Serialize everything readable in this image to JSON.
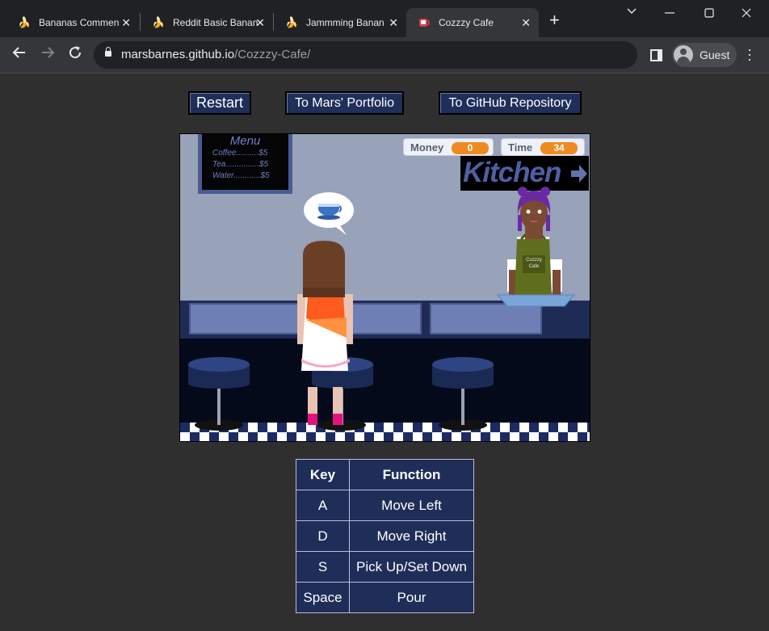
{
  "browser": {
    "tabs": [
      {
        "title": "Bananas Commen",
        "icon": "banana-icon"
      },
      {
        "title": "Reddit Basic Banan",
        "icon": "banana-icon"
      },
      {
        "title": "Jammming Banan",
        "icon": "banana-icon"
      },
      {
        "title": "Cozzzy Cafe",
        "icon": "coffee-cup-icon"
      }
    ],
    "url_domain": "marsbarnes.github.io",
    "url_path": "/Cozzzy-Cafe/",
    "profile_label": "Guest"
  },
  "page": {
    "buttons": {
      "restart": "Restart",
      "portfolio": "To Mars' Portfolio",
      "github": "To GitHub Repository"
    }
  },
  "game": {
    "menu": {
      "title": "Menu",
      "items": [
        "Coffee..........$5",
        "Tea...............$5",
        "Water............$5"
      ]
    },
    "hud": {
      "money_label": "Money",
      "money_value": "0",
      "time_label": "Time",
      "time_value": "34"
    },
    "kitchen_sign": "Kitchen",
    "apron_text_1": "Cozzzy",
    "apron_text_2": "Cafe",
    "order_icon": "coffee-cup-icon"
  },
  "controls": {
    "headers": [
      "Key",
      "Function"
    ],
    "rows": [
      {
        "key": "A",
        "function": "Move Left"
      },
      {
        "key": "D",
        "function": "Move Right"
      },
      {
        "key": "S",
        "function": "Pick Up/Set Down"
      },
      {
        "key": "Space",
        "function": "Pour"
      }
    ]
  },
  "colors": {
    "button_bg": "#1f2f5a",
    "accent_orange": "#ef8a22",
    "wall": "#98a2b9",
    "floor": "#050a1a"
  }
}
